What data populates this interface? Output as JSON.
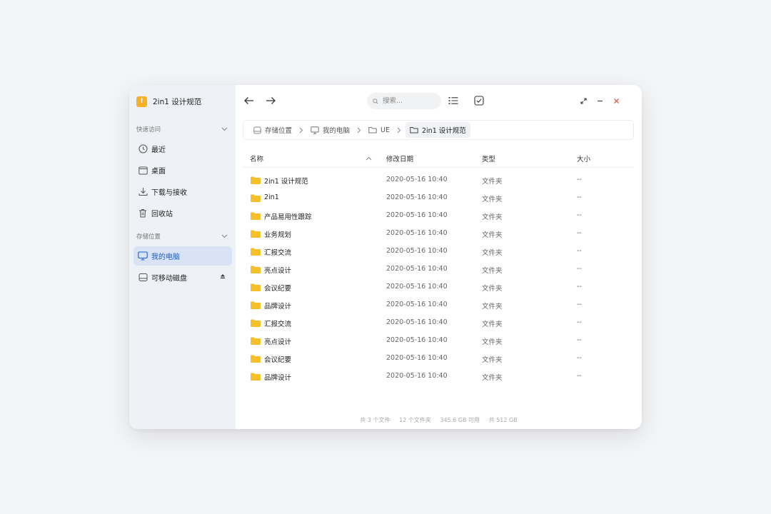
{
  "app": {
    "title": "2in1 设计规范",
    "logo_glyph": "!"
  },
  "colors": {
    "accent": "#1f5fc9",
    "folder": "#f6c02a",
    "sidebar_bg": "#eef1f5",
    "active_bg": "#d8e3f5"
  },
  "sidebar": {
    "quick_access": {
      "header": "快速访问",
      "items": [
        {
          "label": "最近",
          "icon": "clock-icon"
        },
        {
          "label": "桌面",
          "icon": "desktop-icon"
        },
        {
          "label": "下载与接收",
          "icon": "download-icon"
        },
        {
          "label": "回收站",
          "icon": "trash-icon"
        }
      ]
    },
    "storage": {
      "header": "存储位置",
      "items": [
        {
          "label": "我的电脑",
          "icon": "monitor-icon",
          "active": true
        },
        {
          "label": "可移动磁盘",
          "icon": "drive-icon",
          "eject": true
        }
      ]
    }
  },
  "search": {
    "placeholder": "搜索..."
  },
  "breadcrumb": [
    "存储位置",
    "我的电脑",
    "UE",
    "2in1 设计规范"
  ],
  "columns": {
    "name": "名称",
    "date": "修改日期",
    "type": "类型",
    "size": "大小"
  },
  "files": [
    {
      "name": "2in1 设计规范",
      "date": "2020-05-16  10:40",
      "type": "文件夹",
      "size": "--"
    },
    {
      "name": "2in1",
      "date": "2020-05-16  10:40",
      "type": "文件夹",
      "size": "--"
    },
    {
      "name": "产品易用性跟踪",
      "date": "2020-05-16  10:40",
      "type": "文件夹",
      "size": "--"
    },
    {
      "name": "业务规划",
      "date": "2020-05-16  10:40",
      "type": "文件夹",
      "size": "--"
    },
    {
      "name": "汇报交流",
      "date": "2020-05-16  10:40",
      "type": "文件夹",
      "size": "--"
    },
    {
      "name": "亮点设计",
      "date": "2020-05-16  10:40",
      "type": "文件夹",
      "size": "--"
    },
    {
      "name": "会议纪要",
      "date": "2020-05-16  10:40",
      "type": "文件夹",
      "size": "--"
    },
    {
      "name": "品牌设计",
      "date": "2020-05-16  10:40",
      "type": "文件夹",
      "size": "--"
    },
    {
      "name": "汇报交流",
      "date": "2020-05-16  10:40",
      "type": "文件夹",
      "size": "--"
    },
    {
      "name": "亮点设计",
      "date": "2020-05-16  10:40",
      "type": "文件夹",
      "size": "--"
    },
    {
      "name": "会议纪要",
      "date": "2020-05-16  10:40",
      "type": "文件夹",
      "size": "--"
    },
    {
      "name": "品牌设计",
      "date": "2020-05-16  10:40",
      "type": "文件夹",
      "size": "--"
    }
  ],
  "status": {
    "files": "共 3 个文件",
    "folders": "12 个文件夹",
    "available": "345.6 GB 可用",
    "total": "共 512 GB"
  }
}
